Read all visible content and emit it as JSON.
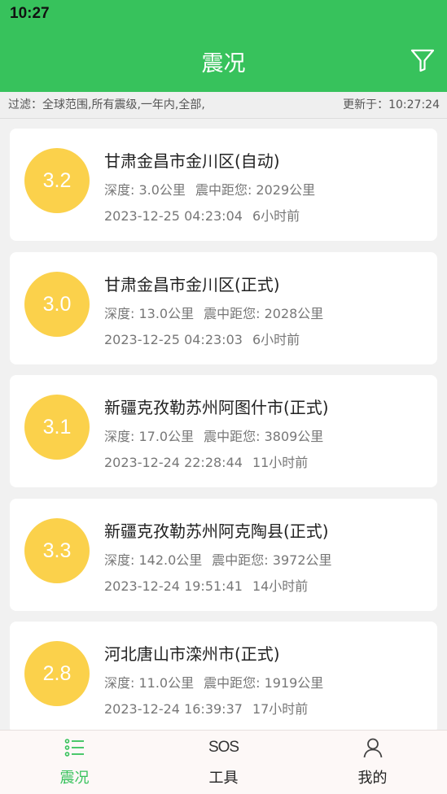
{
  "status_bar": {
    "time": "10:27"
  },
  "header": {
    "title": "震况"
  },
  "filter_bar": {
    "filter_text": "过滤：全球范围,所有震级,一年内,全部,",
    "updated_text": "更新于：10:27:24"
  },
  "quakes": [
    {
      "magnitude": "3.2",
      "place": "甘肃金昌市金川区(自动)",
      "depth": "深度: 3.0公里",
      "distance": "震中距您: 2029公里",
      "datetime": "2023-12-25 04:23:04",
      "ago": "6小时前"
    },
    {
      "magnitude": "3.0",
      "place": "甘肃金昌市金川区(正式)",
      "depth": "深度: 13.0公里",
      "distance": "震中距您: 2028公里",
      "datetime": "2023-12-25 04:23:03",
      "ago": "6小时前"
    },
    {
      "magnitude": "3.1",
      "place": "新疆克孜勒苏州阿图什市(正式)",
      "depth": "深度: 17.0公里",
      "distance": "震中距您: 3809公里",
      "datetime": "2023-12-24 22:28:44",
      "ago": "11小时前"
    },
    {
      "magnitude": "3.3",
      "place": "新疆克孜勒苏州阿克陶县(正式)",
      "depth": "深度: 142.0公里",
      "distance": "震中距您: 3972公里",
      "datetime": "2023-12-24 19:51:41",
      "ago": "14小时前"
    },
    {
      "magnitude": "2.8",
      "place": "河北唐山市滦州市(正式)",
      "depth": "深度: 11.0公里",
      "distance": "震中距您: 1919公里",
      "datetime": "2023-12-24 16:39:37",
      "ago": "17小时前"
    }
  ],
  "tabbar": {
    "tabs": [
      {
        "label": "震况",
        "icon": "list-icon",
        "active": true
      },
      {
        "label": "工具",
        "icon": "SOS",
        "active": false
      },
      {
        "label": "我的",
        "icon": "person-icon",
        "active": false
      }
    ]
  },
  "colors": {
    "primary": "#37c25c",
    "magnitude_badge": "#fbd14b"
  }
}
